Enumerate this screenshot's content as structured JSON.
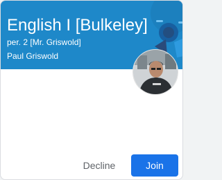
{
  "class_card": {
    "title": "English I [Bulkeley]",
    "section": "per. 2 [Mr. Griswold]",
    "teacher": "Paul Griswold",
    "banner_color": "#1e88c9",
    "avatar_icon": "teacher-photo"
  },
  "actions": {
    "decline_label": "Decline",
    "join_label": "Join",
    "join_color": "#1a73e8"
  }
}
